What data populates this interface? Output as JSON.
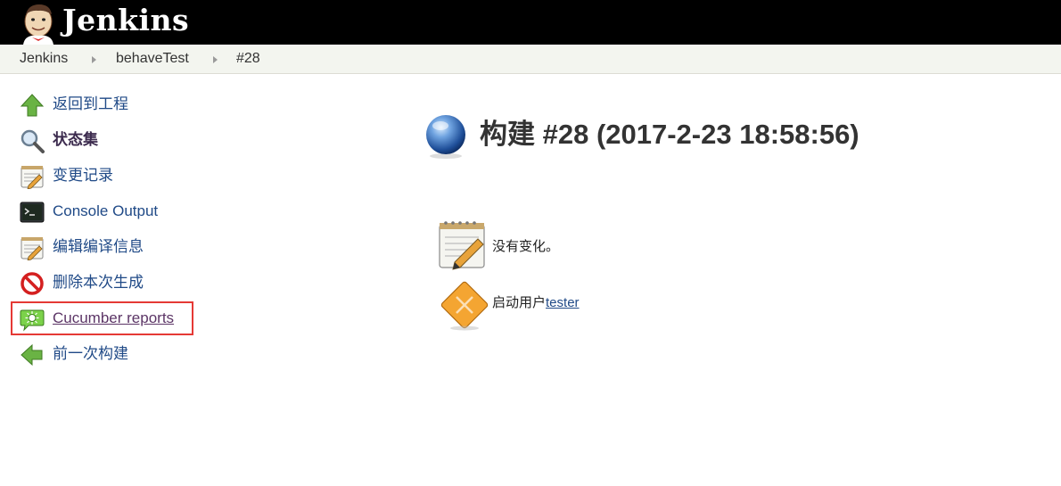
{
  "header": {
    "brand": "Jenkins",
    "logo_icon": "jenkins-butler-logo"
  },
  "breadcrumb": [
    "Jenkins",
    "behaveTest",
    "#28"
  ],
  "sidebar": {
    "items": [
      {
        "label": "返回到工程",
        "icon": "up-arrow-icon"
      },
      {
        "label": "状态集",
        "icon": "magnifier-icon"
      },
      {
        "label": "变更记录",
        "icon": "notepad-icon"
      },
      {
        "label": "Console Output",
        "icon": "terminal-icon"
      },
      {
        "label": "编辑编译信息",
        "icon": "notepad-edit-icon"
      },
      {
        "label": "删除本次生成",
        "icon": "no-entry-icon"
      },
      {
        "label": "Cucumber reports",
        "icon": "cucumber-icon"
      },
      {
        "label": "前一次构建",
        "icon": "left-arrow-icon"
      }
    ]
  },
  "main": {
    "title": "构建 #28 (2017-2-23 18:58:56)",
    "status_icon": "blue-ball-icon",
    "changes_text": "没有变化。",
    "started_by_prefix": "启动用户",
    "started_by_user": "tester"
  },
  "colors": {
    "header_bg": "#000000",
    "breadcrumb_bg": "#f3f5ef",
    "link": "#204a87",
    "highlight": "#e53935"
  }
}
